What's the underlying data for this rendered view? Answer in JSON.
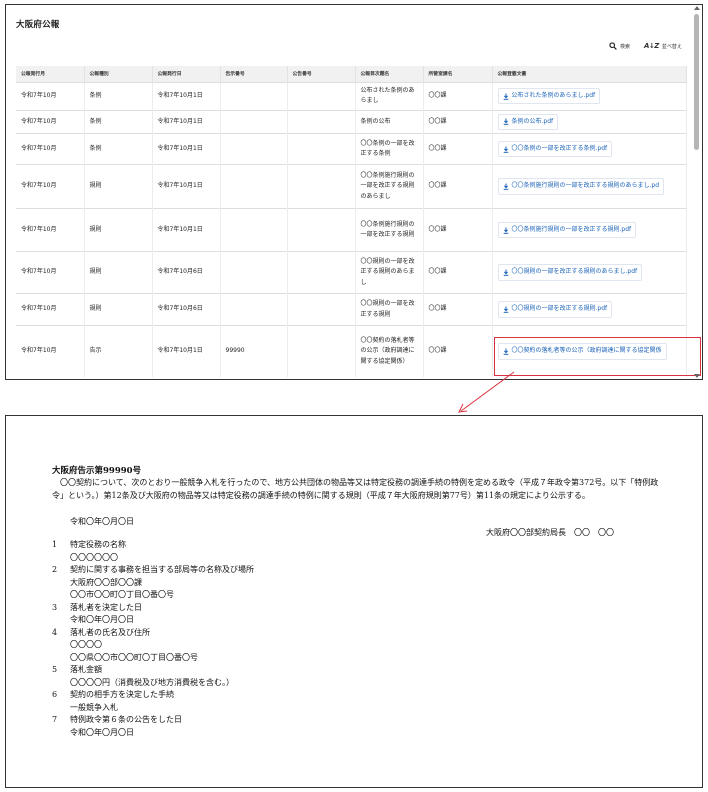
{
  "header": {
    "title": "大阪府公報"
  },
  "toolbar": {
    "search_label": "検索",
    "sort_label": "並べ替え"
  },
  "table": {
    "columns": [
      "公報発行月",
      "公報種別",
      "公報発行日",
      "告示番号",
      "公告番号",
      "公報目次題名",
      "所管室課名",
      "公報登載文書"
    ],
    "rows": [
      {
        "month": "令和7年10月",
        "type": "条例",
        "date": "令和7年10月1日",
        "notice_no": "",
        "ad_no": "",
        "title": "公布された条例のあらまし",
        "dept": "〇〇課",
        "file": "公布された条例のあらまし.pdf"
      },
      {
        "month": "令和7年10月",
        "type": "条例",
        "date": "令和7年10月1日",
        "notice_no": "",
        "ad_no": "",
        "title": "条例の公布",
        "dept": "〇〇課",
        "file": "条例の公布.pdf"
      },
      {
        "month": "令和7年10月",
        "type": "条例",
        "date": "令和7年10月1日",
        "notice_no": "",
        "ad_no": "",
        "title": "〇〇条例の一部を改正する条例",
        "dept": "〇〇課",
        "file": "〇〇条例の一部を改正する条例.pdf"
      },
      {
        "month": "令和7年10月",
        "type": "規則",
        "date": "令和7年10月1日",
        "notice_no": "",
        "ad_no": "",
        "title": "〇〇条例施行規則の一部を改正する規則のあらまし",
        "dept": "〇〇課",
        "file": "〇〇条例施行規則の一部を改正する規則のあらまし.pd"
      },
      {
        "month": "令和7年10月",
        "type": "規則",
        "date": "令和7年10月1日",
        "notice_no": "",
        "ad_no": "",
        "title": "〇〇条例施行規則の一部を改正する規則",
        "dept": "〇〇課",
        "file": "〇〇条例施行規則の一部を改正する規則.pdf"
      },
      {
        "month": "令和7年10月",
        "type": "規則",
        "date": "令和7年10月6日",
        "notice_no": "",
        "ad_no": "",
        "title": "〇〇規則の一部を改正する規則のあらまし",
        "dept": "〇〇課",
        "file": "〇〇規則の一部を改正する規則のあらまし.pdf"
      },
      {
        "month": "令和7年10月",
        "type": "規則",
        "date": "令和7年10月6日",
        "notice_no": "",
        "ad_no": "",
        "title": "〇〇規則の一部を改正する規則",
        "dept": "〇〇課",
        "file": "〇〇規則の一部を改正する規則.pdf"
      },
      {
        "month": "令和7年10月",
        "type": "告示",
        "date": "令和7年10月1日",
        "notice_no": "99990",
        "ad_no": "",
        "title": "〇〇契約の落札者等の公示（政府調達に関する協定関係）",
        "dept": "〇〇課",
        "file": "〇〇契約の落札者等の公示（政府調達に関する協定関係"
      }
    ]
  },
  "notice": {
    "heading": "大阪府告示第99990号",
    "body": "　〇〇契約について、次のとおり一般競争入札を行ったので、地方公共団体の物品等又は特定役務の調達手続の特例を定める政令（平成７年政令第372号。以下「特例政令」という。）第12条及び大阪府の物品等又は特定役務の調達手続の特例に関する規則（平成７年大阪府規則第77号）第11条の規定により公示する。",
    "date": "令和〇年〇月〇日",
    "signer": "大阪府〇〇部契約局長　〇〇　〇〇",
    "items": [
      {
        "num": "1",
        "label": "特定役務の名称",
        "lines": [
          "〇〇〇〇〇〇"
        ]
      },
      {
        "num": "2",
        "label": "契約に関する事務を担当する部局等の名称及び場所",
        "lines": [
          "大阪府〇〇部〇〇課",
          "〇〇市〇〇町〇丁目〇番〇号"
        ]
      },
      {
        "num": "3",
        "label": "落札者を決定した日",
        "lines": [
          "令和〇年〇月〇日"
        ]
      },
      {
        "num": "4",
        "label": "落札者の氏名及び住所",
        "lines": [
          "〇〇〇〇",
          "〇〇県〇〇市〇〇町〇丁目〇番〇号"
        ]
      },
      {
        "num": "5",
        "label": "落札金額",
        "lines": [
          "〇〇〇〇円（消費税及び地方消費税を含む。）"
        ]
      },
      {
        "num": "6",
        "label": "契約の相手方を決定した手続",
        "lines": [
          "一般競争入札"
        ]
      },
      {
        "num": "7",
        "label": "特例政令第６条の公告をした日",
        "lines": [
          "令和〇年〇月〇日"
        ]
      }
    ]
  },
  "colors": {
    "link": "#1a62b8",
    "highlight": "#d9323f",
    "header_bg": "#f1f1f1"
  },
  "icons": {
    "search": "search-icon",
    "sort": "az-sort-icon",
    "download": "download-icon"
  }
}
